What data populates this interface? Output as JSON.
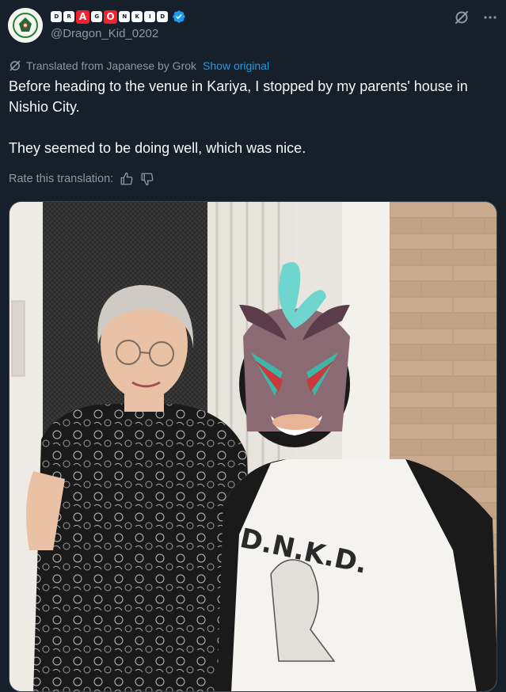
{
  "author": {
    "display_name_glyphs": [
      "D",
      "R",
      "A",
      "G",
      "O",
      "N",
      "K",
      "I",
      "D"
    ],
    "handle": "@Dragon_Kid_0202",
    "verified": true
  },
  "icons": {
    "grok_icon": "grok-icon",
    "more_icon": "more-options-icon",
    "translate_icon": "translate-icon",
    "thumb_up": "thumbs-up-icon",
    "thumb_down": "thumbs-down-icon"
  },
  "translation": {
    "label": "Translated from Japanese by Grok",
    "show_original": "Show original"
  },
  "tweet": {
    "line1": "Before heading to the venue in Kariya, I stopped by my parents' house in Nishio City.",
    "line2": "They seemed to be doing well, which was nice."
  },
  "rate": {
    "label": "Rate this translation:"
  },
  "photo": {
    "shirt_text": "D.N.K.D."
  },
  "colors": {
    "background": "#15202b",
    "text": "#f7f9f9",
    "muted": "#8b98a5",
    "link": "#1d9bf0",
    "accent_red": "#f4212e"
  }
}
